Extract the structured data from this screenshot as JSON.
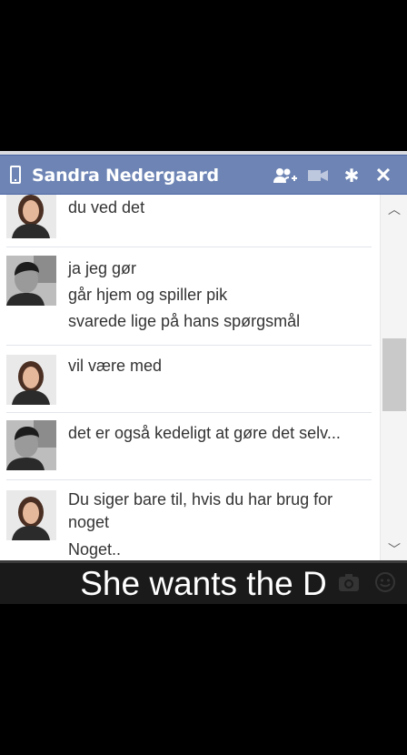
{
  "chat": {
    "contact_name": "Sandra Nedergaard",
    "header_icons": [
      "phone-icon",
      "add-people-icon",
      "video-icon",
      "settings-icon",
      "close-icon"
    ],
    "header_color": "#6d84b4",
    "messages": [
      {
        "sender": "Sandra",
        "avatar": "avatar-sandra",
        "lines": [
          "du ved det"
        ]
      },
      {
        "sender": "me",
        "avatar": "avatar-me",
        "lines": [
          "ja jeg gør",
          "går hjem og spiller pik",
          "svarede lige på hans spørgsmål"
        ]
      },
      {
        "sender": "Sandra",
        "avatar": "avatar-sandra",
        "lines": [
          "vil være med"
        ]
      },
      {
        "sender": "me",
        "avatar": "avatar-me",
        "lines": [
          "det er også kedeligt at gøre det selv..."
        ]
      },
      {
        "sender": "Sandra",
        "avatar": "avatar-sandra",
        "lines": [
          "Du siger bare til, hvis du har brug for noget",
          "Noget.."
        ]
      }
    ]
  },
  "caption": "She wants the D"
}
